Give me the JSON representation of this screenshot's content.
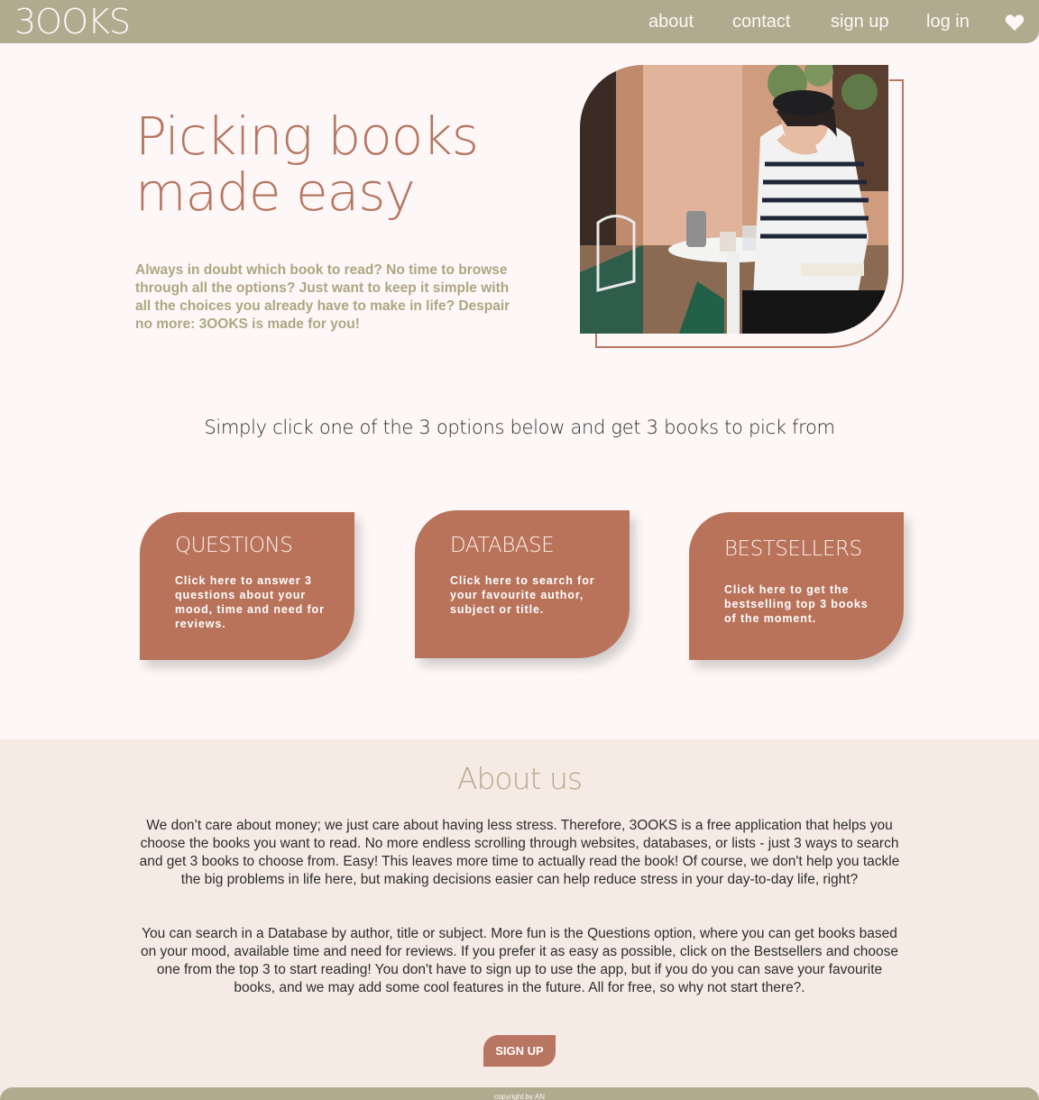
{
  "nav": {
    "logo": "3OOKS",
    "links": [
      "about",
      "contact",
      "sign up",
      "log in"
    ],
    "favourite_icon": "heart-icon"
  },
  "hero": {
    "title_line1": "Picking books",
    "title_line2": "made easy",
    "text": "Always in doubt which book to read? No time to browse through all the options? Just want to keep it simple with all the choices you already have to make in life? Despair no more: 3OOKS is made for you!",
    "image": "woman-at-cafe-table-photo"
  },
  "prompt": "Simply click one of the 3 options below and get 3 books to pick from",
  "cards": [
    {
      "title": "QUESTIONS",
      "text": "Click here to answer 3 questions about your mood, time and need for reviews."
    },
    {
      "title": "DATABASE",
      "text": "Click here to search for your favourite author, subject or title."
    },
    {
      "title": "BESTSELLERS",
      "text": "Click here to get the bestselling top 3 books of the moment."
    }
  ],
  "about": {
    "title": "About us",
    "p1": "We don’t care about money; we just care about having less stress. Therefore, 3OOKS is a free application that helps you choose the books you want to read. No more endless scrolling through websites, databases, or lists - just 3 ways to search and get 3 books to choose from. Easy! This leaves more time to actually read the book! Of course, we don't help you tackle the big problems in life here, but making decisions easier can help reduce stress in your day-to-day life, right?",
    "p2": "You can search in a Database by author, title or subject. More fun is the Questions option, where you can get books based on your mood, available time and need for reviews. If you prefer it as easy as possible, click on the Bestsellers and choose one from the top 3 to start reading! You don't have to sign up to use the app, but if you do you can save your favourite books, and we may add some cool features in the future. All for free, so why not start there?.",
    "signup_label": "SIGN UP"
  },
  "footer": {
    "text": "copyright by AN"
  },
  "colors": {
    "nav_bg": "#b0aa8e",
    "accent": "#b9735b",
    "page_bg": "#fdf8f7",
    "about_bg": "#f5ebe4"
  }
}
